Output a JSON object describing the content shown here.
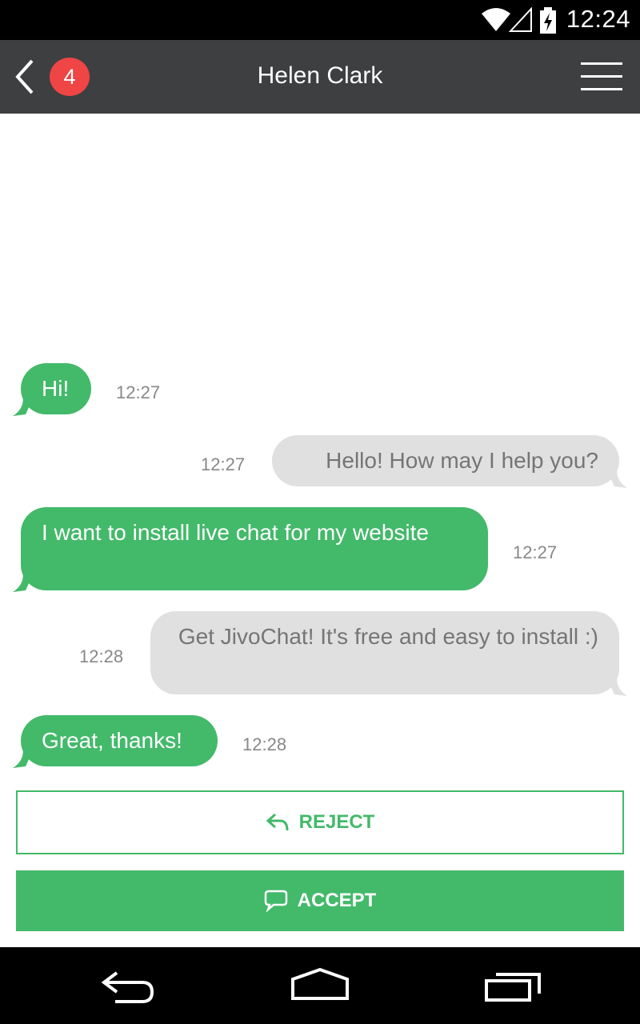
{
  "status_bar": {
    "time": "12:24"
  },
  "header": {
    "unread_count": "4",
    "contact_name": "Helen Clark"
  },
  "messages": [
    {
      "direction": "incoming",
      "text": "Hi!",
      "time": "12:27"
    },
    {
      "direction": "outgoing",
      "text": "Hello! How may I help you?",
      "time": "12:27"
    },
    {
      "direction": "incoming",
      "text": "I want to install live chat for my website",
      "time": "12:27"
    },
    {
      "direction": "outgoing",
      "text": "Get JivoChat! It's free and easy to install :)",
      "time": "12:28"
    },
    {
      "direction": "incoming",
      "text": "Great, thanks!",
      "time": "12:28"
    }
  ],
  "actions": {
    "reject_label": "REJECT",
    "accept_label": "ACCEPT"
  },
  "colors": {
    "accent_green": "#43b96a",
    "header_bg": "#3e3f41",
    "badge_red": "#f04545",
    "outgoing_bubble": "#e0e0e0"
  }
}
